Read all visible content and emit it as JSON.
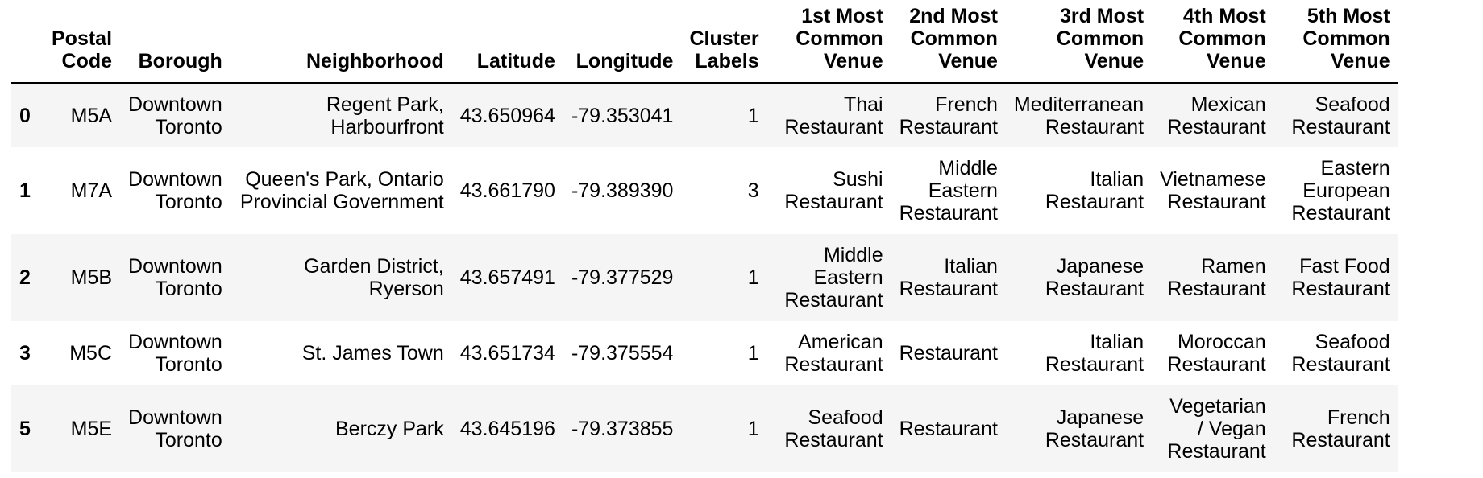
{
  "table": {
    "columns": [
      {
        "key": "index",
        "label": ""
      },
      {
        "key": "postal_code",
        "label": "Postal Code"
      },
      {
        "key": "borough",
        "label": "Borough"
      },
      {
        "key": "neighborhood",
        "label": "Neighborhood"
      },
      {
        "key": "latitude",
        "label": "Latitude"
      },
      {
        "key": "longitude",
        "label": "Longitude"
      },
      {
        "key": "cluster_labels",
        "label": "Cluster Labels"
      },
      {
        "key": "venue1",
        "label": "1st Most Common Venue"
      },
      {
        "key": "venue2",
        "label": "2nd Most Common Venue"
      },
      {
        "key": "venue3",
        "label": "3rd Most Common Venue"
      },
      {
        "key": "venue4",
        "label": "4th Most Common Venue"
      },
      {
        "key": "venue5",
        "label": "5th Most Common Venue"
      }
    ],
    "rows": [
      {
        "index": "0",
        "postal_code": "M5A",
        "borough": "Downtown Toronto",
        "neighborhood": "Regent Park, Harbourfront",
        "latitude": "43.650964",
        "longitude": "-79.353041",
        "cluster_labels": "1",
        "venue1": "Thai Restaurant",
        "venue2": "French Restaurant",
        "venue3": "Mediterranean Restaurant",
        "venue4": "Mexican Restaurant",
        "venue5": "Seafood Restaurant"
      },
      {
        "index": "1",
        "postal_code": "M7A",
        "borough": "Downtown Toronto",
        "neighborhood": "Queen's Park, Ontario Provincial Government",
        "latitude": "43.661790",
        "longitude": "-79.389390",
        "cluster_labels": "3",
        "venue1": "Sushi Restaurant",
        "venue2": "Middle Eastern Restaurant",
        "venue3": "Italian Restaurant",
        "venue4": "Vietnamese Restaurant",
        "venue5": "Eastern European Restaurant"
      },
      {
        "index": "2",
        "postal_code": "M5B",
        "borough": "Downtown Toronto",
        "neighborhood": "Garden District, Ryerson",
        "latitude": "43.657491",
        "longitude": "-79.377529",
        "cluster_labels": "1",
        "venue1": "Middle Eastern Restaurant",
        "venue2": "Italian Restaurant",
        "venue3": "Japanese Restaurant",
        "venue4": "Ramen Restaurant",
        "venue5": "Fast Food Restaurant"
      },
      {
        "index": "3",
        "postal_code": "M5C",
        "borough": "Downtown Toronto",
        "neighborhood": "St. James Town",
        "latitude": "43.651734",
        "longitude": "-79.375554",
        "cluster_labels": "1",
        "venue1": "American Restaurant",
        "venue2": "Restaurant",
        "venue3": "Italian Restaurant",
        "venue4": "Moroccan Restaurant",
        "venue5": "Seafood Restaurant"
      },
      {
        "index": "5",
        "postal_code": "M5E",
        "borough": "Downtown Toronto",
        "neighborhood": "Berczy Park",
        "latitude": "43.645196",
        "longitude": "-79.373855",
        "cluster_labels": "1",
        "venue1": "Seafood Restaurant",
        "venue2": "Restaurant",
        "venue3": "Japanese Restaurant",
        "venue4": "Vegetarian / Vegan Restaurant",
        "venue5": "French Restaurant"
      }
    ]
  }
}
